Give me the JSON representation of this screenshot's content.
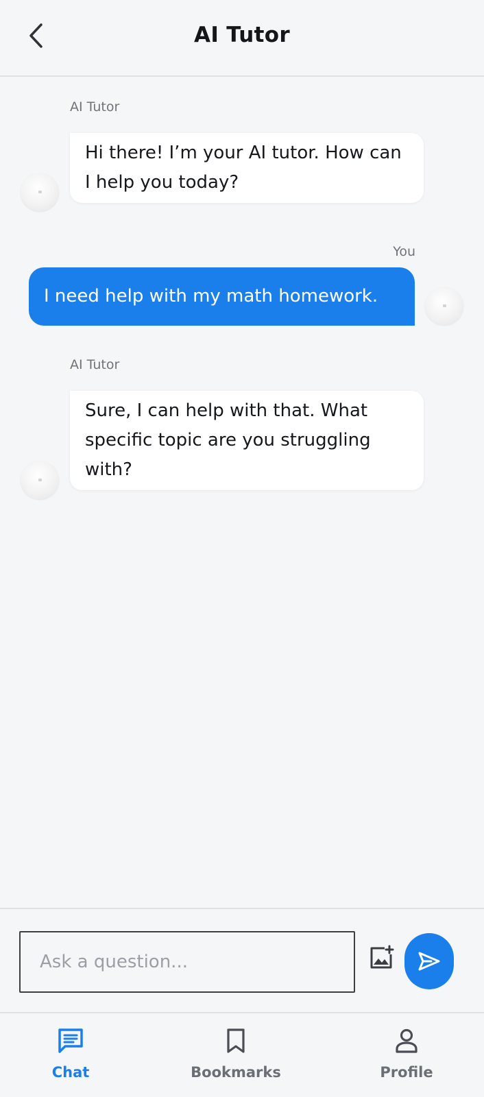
{
  "header": {
    "title": "AI Tutor",
    "back_icon": "chevron-left-icon"
  },
  "messages": [
    {
      "sender": "AI Tutor",
      "role": "bot",
      "text": "Hi there! I’m your AI tutor. How can I help you today?"
    },
    {
      "sender": "You",
      "role": "user",
      "text": "I need help with my math homework."
    },
    {
      "sender": "AI Tutor",
      "role": "bot",
      "text": "Sure, I can help with that. What specific topic are you struggling with?"
    }
  ],
  "composer": {
    "placeholder": "Ask a question...",
    "value": "",
    "image_icon": "add-image-icon",
    "send_icon": "send-icon"
  },
  "nav": {
    "items": [
      {
        "label": "Chat",
        "icon": "chat-icon",
        "active": true
      },
      {
        "label": "Bookmarks",
        "icon": "bookmark-icon",
        "active": false
      },
      {
        "label": "Profile",
        "icon": "profile-icon",
        "active": false
      }
    ]
  },
  "colors": {
    "accent": "#1a7fea",
    "background": "#f5f6f8",
    "bot_bubble": "#ffffff",
    "user_bubble": "#1a7fea",
    "muted_text": "#6f737a"
  }
}
